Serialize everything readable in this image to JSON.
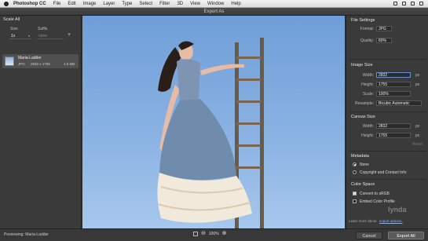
{
  "menubar": {
    "app": "Photoshop CC",
    "items": [
      "File",
      "Edit",
      "Image",
      "Layer",
      "Type",
      "Select",
      "Filter",
      "3D",
      "View",
      "Window",
      "Help"
    ]
  },
  "dialog": {
    "title": "Export As"
  },
  "left": {
    "section": "Scale All",
    "size_label": "Size",
    "suffix_label": "Suffix",
    "size_value": "1x",
    "suffix_placeholder": "none",
    "asset": {
      "name": "Maria-Ladder",
      "format": "JPG",
      "dimensions": "2832 x 1755",
      "filesize": "1.5 MB"
    }
  },
  "right": {
    "file_settings": {
      "head": "File Settings",
      "format_label": "Format:",
      "format_value": "JPG",
      "quality_label": "Quality:",
      "quality_value": "80%"
    },
    "image_size": {
      "head": "Image Size",
      "width_label": "Width:",
      "width_value": "2832",
      "height_label": "Height:",
      "height_value": "1755",
      "scale_label": "Scale:",
      "scale_value": "100%",
      "resample_label": "Resample:",
      "resample_value": "Bicubic Automatic",
      "unit": "px"
    },
    "canvas_size": {
      "head": "Canvas Size",
      "width_label": "Width:",
      "width_value": "2832",
      "height_label": "Height:",
      "height_value": "1755",
      "unit": "px",
      "reset": "Reset"
    },
    "metadata": {
      "head": "Metadata",
      "none": "None",
      "copyright": "Copyright and Contact Info"
    },
    "color_space": {
      "head": "Color Space",
      "convert": "Convert to sRGB",
      "embed": "Embed Color Profile"
    },
    "learn_more": "Learn more about",
    "learn_more_link": "export options."
  },
  "bottom": {
    "previewing": "Previewing: Maria-Ladder",
    "zoom": "100%",
    "cancel": "Cancel",
    "export": "Export All"
  },
  "watermark": "lynda"
}
